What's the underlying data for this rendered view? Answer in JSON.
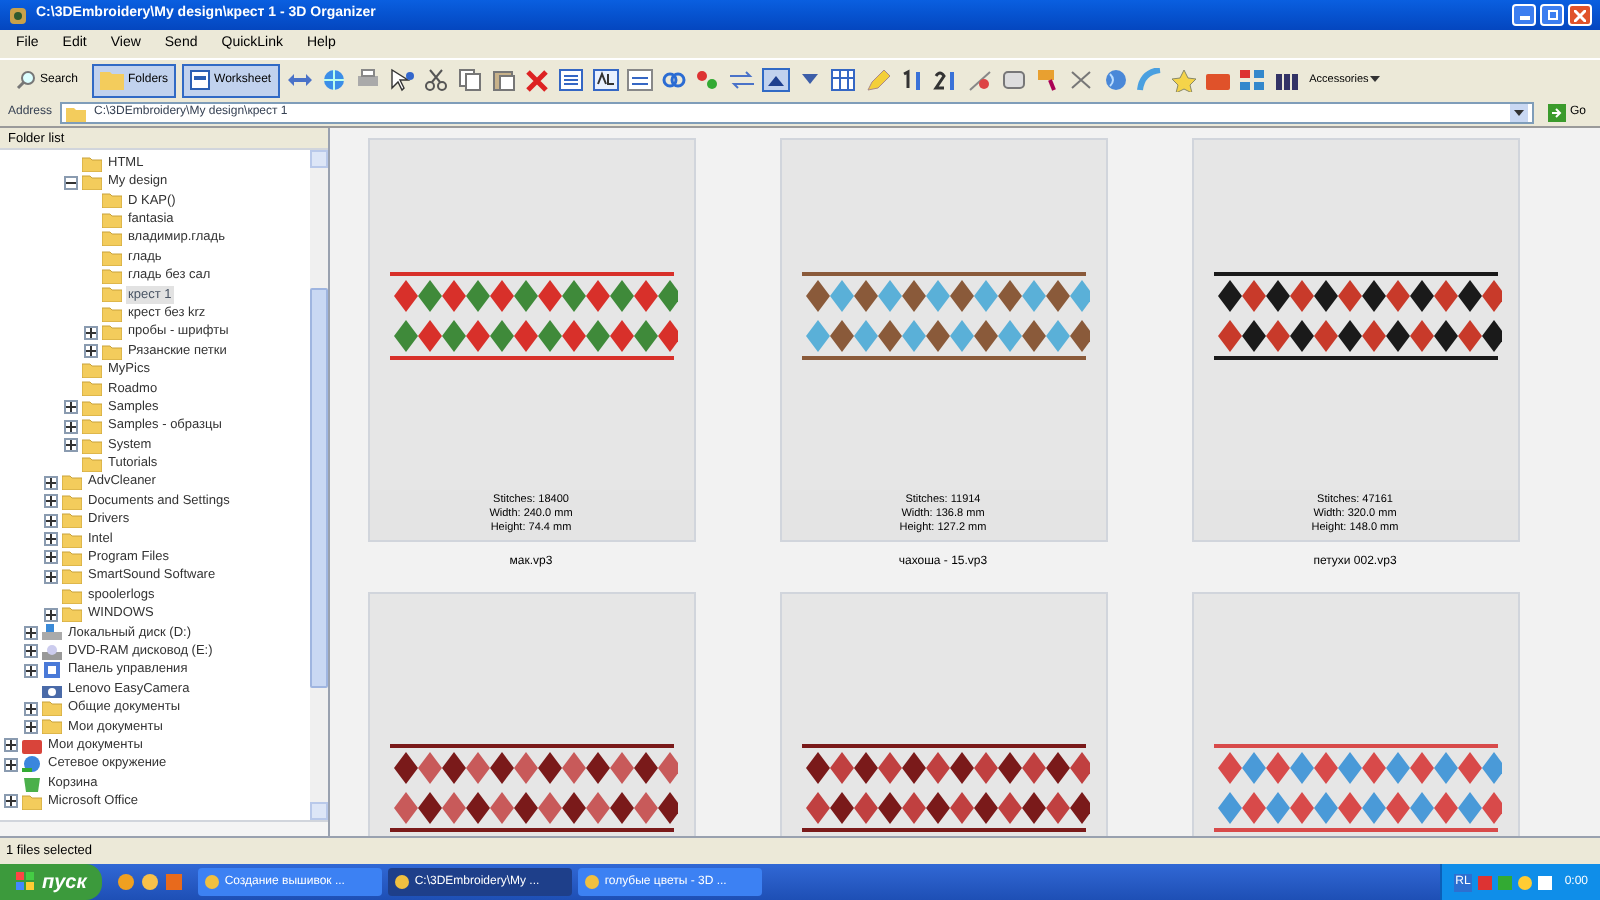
{
  "window": {
    "title": "C:\\3DEmbroidery\\My design\\крест 1 - 3D Organizer"
  },
  "menu": [
    "File",
    "Edit",
    "View",
    "Send",
    "QuickLink",
    "Help"
  ],
  "toolbar": {
    "buttons": [
      {
        "label": "Search",
        "selected": false
      },
      {
        "label": "Folders",
        "selected": true
      },
      {
        "label": "Worksheet",
        "selected": true
      }
    ],
    "accessories": "Accessories"
  },
  "address": {
    "label": "Address",
    "value": "C:\\3DEmbroidery\\My design\\крест 1",
    "go": "Go"
  },
  "folder_list": {
    "title": "Folder list",
    "tree": [
      {
        "children": [
          {
            "children": [
              {
                "children": [
                  {
                    "label": "HTML",
                    "kind": "folder"
                  },
                  {
                    "label": "My design",
                    "kind": "folder",
                    "expanded": true,
                    "children": [
                      {
                        "label": "D KAP()",
                        "kind": "folder"
                      },
                      {
                        "label": "fantasia",
                        "kind": "folder"
                      },
                      {
                        "label": "владимир.гладь",
                        "kind": "folder"
                      },
                      {
                        "label": "гладь",
                        "kind": "folder"
                      },
                      {
                        "label": "гладь без сал",
                        "kind": "folder"
                      },
                      {
                        "label": "крест 1",
                        "kind": "folder",
                        "selected": true
                      },
                      {
                        "label": "крест без krz",
                        "kind": "folder"
                      },
                      {
                        "label": "пробы - шрифты",
                        "kind": "folder",
                        "expanded": false
                      },
                      {
                        "label": "Рязанские петки",
                        "kind": "folder",
                        "expanded": false
                      }
                    ]
                  },
                  {
                    "label": "MyPics",
                    "kind": "folder"
                  },
                  {
                    "label": "Roadmo",
                    "kind": "folder"
                  },
                  {
                    "label": "Samples",
                    "kind": "folder",
                    "expanded": false
                  },
                  {
                    "label": "Samples - образцы",
                    "kind": "folder",
                    "expanded": false
                  },
                  {
                    "label": "System",
                    "kind": "folder",
                    "expanded": false
                  },
                  {
                    "label": "Tutorials",
                    "kind": "folder"
                  }
                ]
              },
              {
                "label": "AdvCleaner",
                "kind": "folder",
                "expanded": false
              },
              {
                "label": "Documents and Settings",
                "kind": "folder",
                "expanded": false
              },
              {
                "label": "Drivers",
                "kind": "folder",
                "expanded": false
              },
              {
                "label": "Intel",
                "kind": "folder",
                "expanded": false
              },
              {
                "label": "Program Files",
                "kind": "folder",
                "expanded": false
              },
              {
                "label": "SmartSound Software",
                "kind": "folder",
                "expanded": false
              },
              {
                "label": "spoolerlogs",
                "kind": "folder"
              },
              {
                "label": "WINDOWS",
                "kind": "folder",
                "expanded": false
              }
            ]
          },
          {
            "label": "Локальный диск (D:)",
            "kind": "drive",
            "expanded": false
          },
          {
            "label": "DVD-RAM дисковод (E:)",
            "kind": "dvd",
            "expanded": false
          },
          {
            "label": "Панель управления",
            "kind": "panel",
            "expanded": false
          },
          {
            "label": "Lenovo EasyCamera",
            "kind": "camera"
          },
          {
            "label": "Общие документы",
            "kind": "folder",
            "expanded": false
          },
          {
            "label": "Мои документы",
            "kind": "folder",
            "expanded": false
          }
        ]
      },
      {
        "label": "Мои документы",
        "kind": "documents",
        "expanded": false
      },
      {
        "label": "Сетевое окружение",
        "kind": "network",
        "expanded": false
      },
      {
        "label": "Корзина",
        "kind": "bin"
      },
      {
        "label": "Microsoft Office",
        "kind": "folder",
        "expanded": false
      }
    ]
  },
  "thumbnails": [
    {
      "kind": "full",
      "stitches": "Stitches: 18400",
      "width": "Width: 240.0 mm",
      "height": "Height: 74.4 mm",
      "file": "мак.vp3"
    },
    {
      "kind": "full",
      "stitches": "Stitches: 11914",
      "width": "Width: 136.8 mm",
      "height": "Height: 127.2 mm",
      "file": "чахоша - 15.vp3"
    },
    {
      "kind": "full",
      "stitches": "Stitches: 47161",
      "width": "Width: 320.0 mm",
      "height": "Height: 148.0 mm",
      "file": "петухи 002.vp3"
    },
    {
      "kind": "cut_off"
    },
    {
      "kind": "cut_off"
    },
    {
      "kind": "cut_off"
    }
  ],
  "status_bar": "1 files selected",
  "taskbar": {
    "start": "пуск",
    "tasks": [
      {
        "label": "Создание вышивок ...",
        "selected": false
      },
      {
        "label": "C:\\3DEmbroidery\\My ...",
        "selected": true
      },
      {
        "label": "голубые цветы - 3D ...",
        "selected": false
      }
    ],
    "language": "RL",
    "clock": "0:00"
  }
}
